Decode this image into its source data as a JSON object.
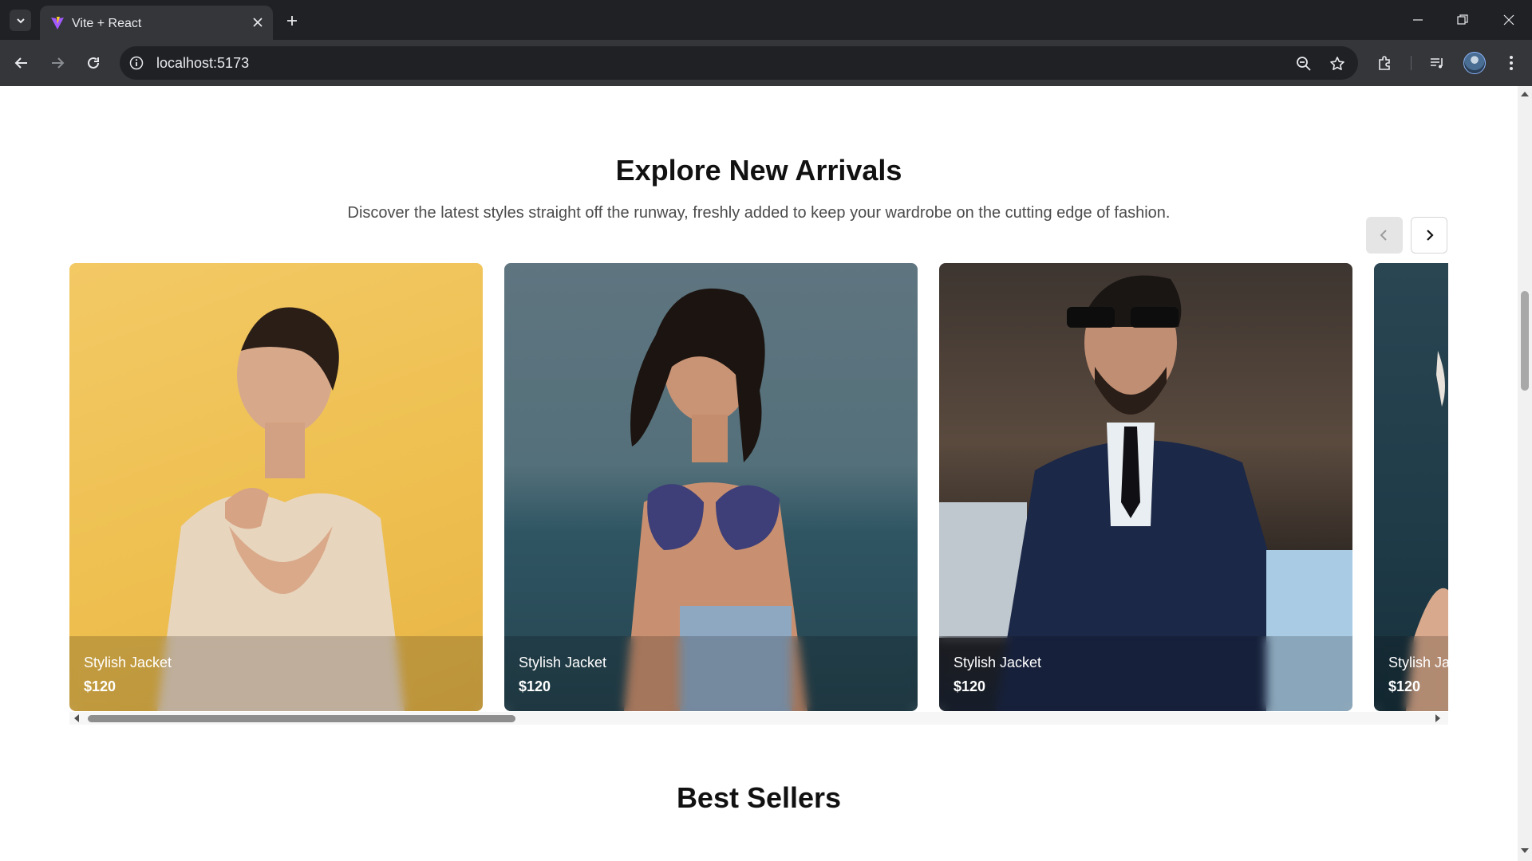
{
  "browser": {
    "tab_title": "Vite + React",
    "url": "localhost:5173"
  },
  "section_arrivals": {
    "title": "Explore New Arrivals",
    "subtitle": "Discover the latest styles straight off the runway, freshly added to keep your wardrobe on the cutting edge of fashion."
  },
  "carousel": {
    "cards": [
      {
        "name": "Stylish Jacket",
        "price": "$120"
      },
      {
        "name": "Stylish Jacket",
        "price": "$120"
      },
      {
        "name": "Stylish Jacket",
        "price": "$120"
      },
      {
        "name": "Stylish Jacket",
        "price": "$120"
      }
    ],
    "scroll_position": 0.0
  },
  "section_best": {
    "title": "Best Sellers"
  },
  "icons": {
    "tab_search": "chevron-down-icon",
    "favicon": "vite-logo-icon",
    "tab_close": "close-icon",
    "new_tab": "plus-icon",
    "back": "arrow-left-icon",
    "forward": "arrow-right-icon",
    "reload": "reload-icon",
    "site_info": "info-icon",
    "zoom": "zoom-icon",
    "bookmark": "star-icon",
    "extensions": "puzzle-icon",
    "media": "media-control-icon",
    "menu": "kebab-menu-icon",
    "carousel_prev": "chevron-left-icon",
    "carousel_next": "chevron-right-icon"
  },
  "colors": {
    "chrome_dark": "#202124",
    "chrome_toolbar": "#35363a",
    "page_bg": "#ffffff",
    "heading": "#111111"
  }
}
